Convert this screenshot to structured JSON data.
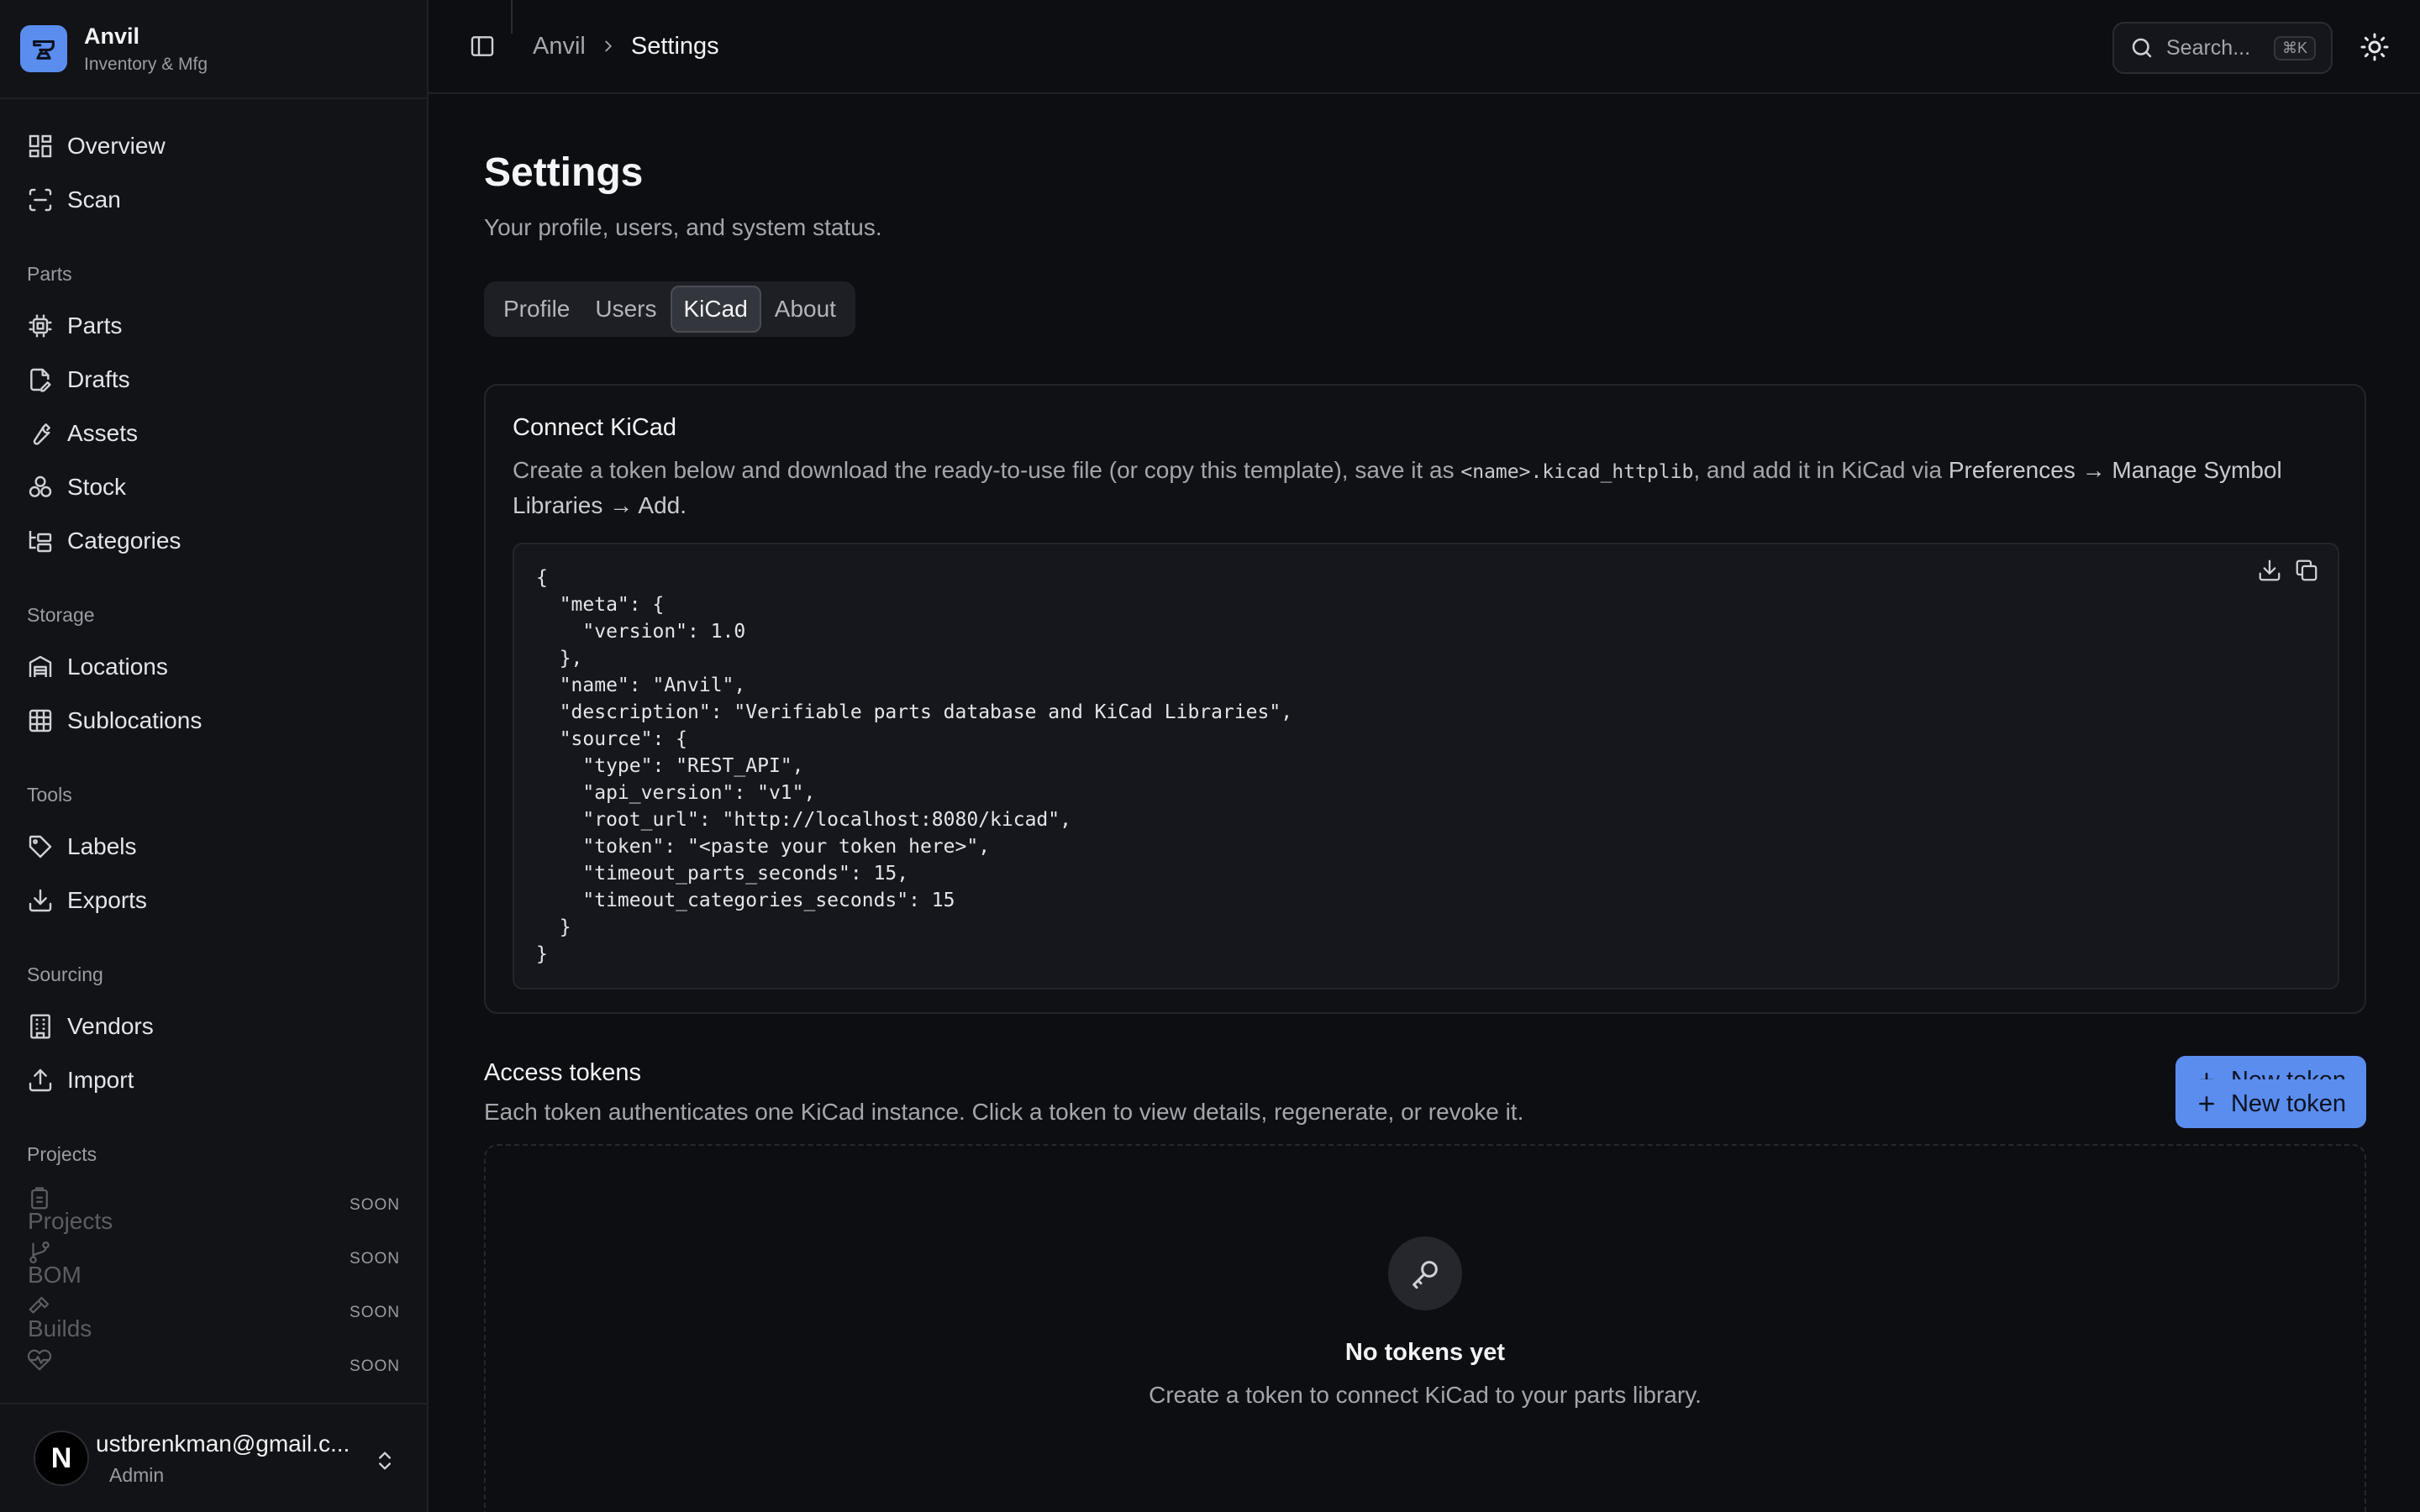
{
  "brand": {
    "name": "Anvil",
    "subtitle": "Inventory & Mfg"
  },
  "sidebar": {
    "top_items": [
      {
        "label": "Overview",
        "icon": "layout-grid-icon"
      },
      {
        "label": "Scan",
        "icon": "scan-icon"
      }
    ],
    "sections": [
      {
        "title": "Parts",
        "items": [
          {
            "label": "Parts",
            "icon": "chip-icon"
          },
          {
            "label": "Drafts",
            "icon": "file-pen-icon"
          },
          {
            "label": "Assets",
            "icon": "wrench-icon"
          },
          {
            "label": "Stock",
            "icon": "boxes-icon"
          },
          {
            "label": "Categories",
            "icon": "folder-tree-icon"
          }
        ]
      },
      {
        "title": "Storage",
        "items": [
          {
            "label": "Locations",
            "icon": "warehouse-icon"
          },
          {
            "label": "Sublocations",
            "icon": "grid-icon"
          }
        ]
      },
      {
        "title": "Tools",
        "items": [
          {
            "label": "Labels",
            "icon": "tag-icon"
          },
          {
            "label": "Exports",
            "icon": "download-icon"
          }
        ]
      },
      {
        "title": "Sourcing",
        "items": [
          {
            "label": "Vendors",
            "icon": "building-icon"
          },
          {
            "label": "Import",
            "icon": "upload-icon"
          }
        ]
      }
    ],
    "projects": {
      "title": "Projects",
      "items": [
        {
          "label": "Projects",
          "badge": "SOON",
          "icon": "clipboard-icon"
        },
        {
          "label": "BOM",
          "badge": "SOON",
          "icon": "git-branch-icon"
        },
        {
          "label": "Builds",
          "badge": "SOON",
          "icon": "hammer-icon"
        },
        {
          "label": "",
          "badge": "SOON",
          "icon": "heart-pulse-icon"
        }
      ]
    }
  },
  "user": {
    "initial": "N",
    "email": "ustbrenkman@gmail.c...",
    "role": "Admin"
  },
  "header": {
    "breadcrumb": [
      "Anvil",
      "Settings"
    ],
    "search_placeholder": "Search...",
    "search_shortcut": "⌘K"
  },
  "page": {
    "title": "Settings",
    "subtitle": "Your profile, users, and system status.",
    "tabs": [
      "Profile",
      "Users",
      "KiCad",
      "About"
    ],
    "active_tab": "KiCad"
  },
  "kicad_card": {
    "title": "Connect KiCad",
    "desc_part1": "Create a token below and download the ready-to-use file (or copy this template), save it as ",
    "desc_code": "<name>.kicad_httplib",
    "desc_part2": ", and add it in KiCad via ",
    "desc_path": "Preferences → Manage Symbol Libraries → Add.",
    "code": "{\n  \"meta\": {\n    \"version\": 1.0\n  },\n  \"name\": \"Anvil\",\n  \"description\": \"Verifiable parts database and KiCad Libraries\",\n  \"source\": {\n    \"type\": \"REST_API\",\n    \"api_version\": \"v1\",\n    \"root_url\": \"http://localhost:8080/kicad\",\n    \"token\": \"<paste your token here>\",\n    \"timeout_parts_seconds\": 15,\n    \"timeout_categories_seconds\": 15\n  }\n}"
  },
  "access_tokens": {
    "title": "Access tokens",
    "subtitle": "Each token authenticates one KiCad instance. Click a token to view details, regenerate, or revoke it.",
    "new_button": "New token",
    "empty_title": "No tokens yet",
    "empty_subtitle": "Create a token to connect KiCad to your parts library.",
    "empty_button": "New token"
  },
  "colors": {
    "accent": "#5b8def",
    "background": "#0d0e12",
    "sidebar": "#121317"
  }
}
